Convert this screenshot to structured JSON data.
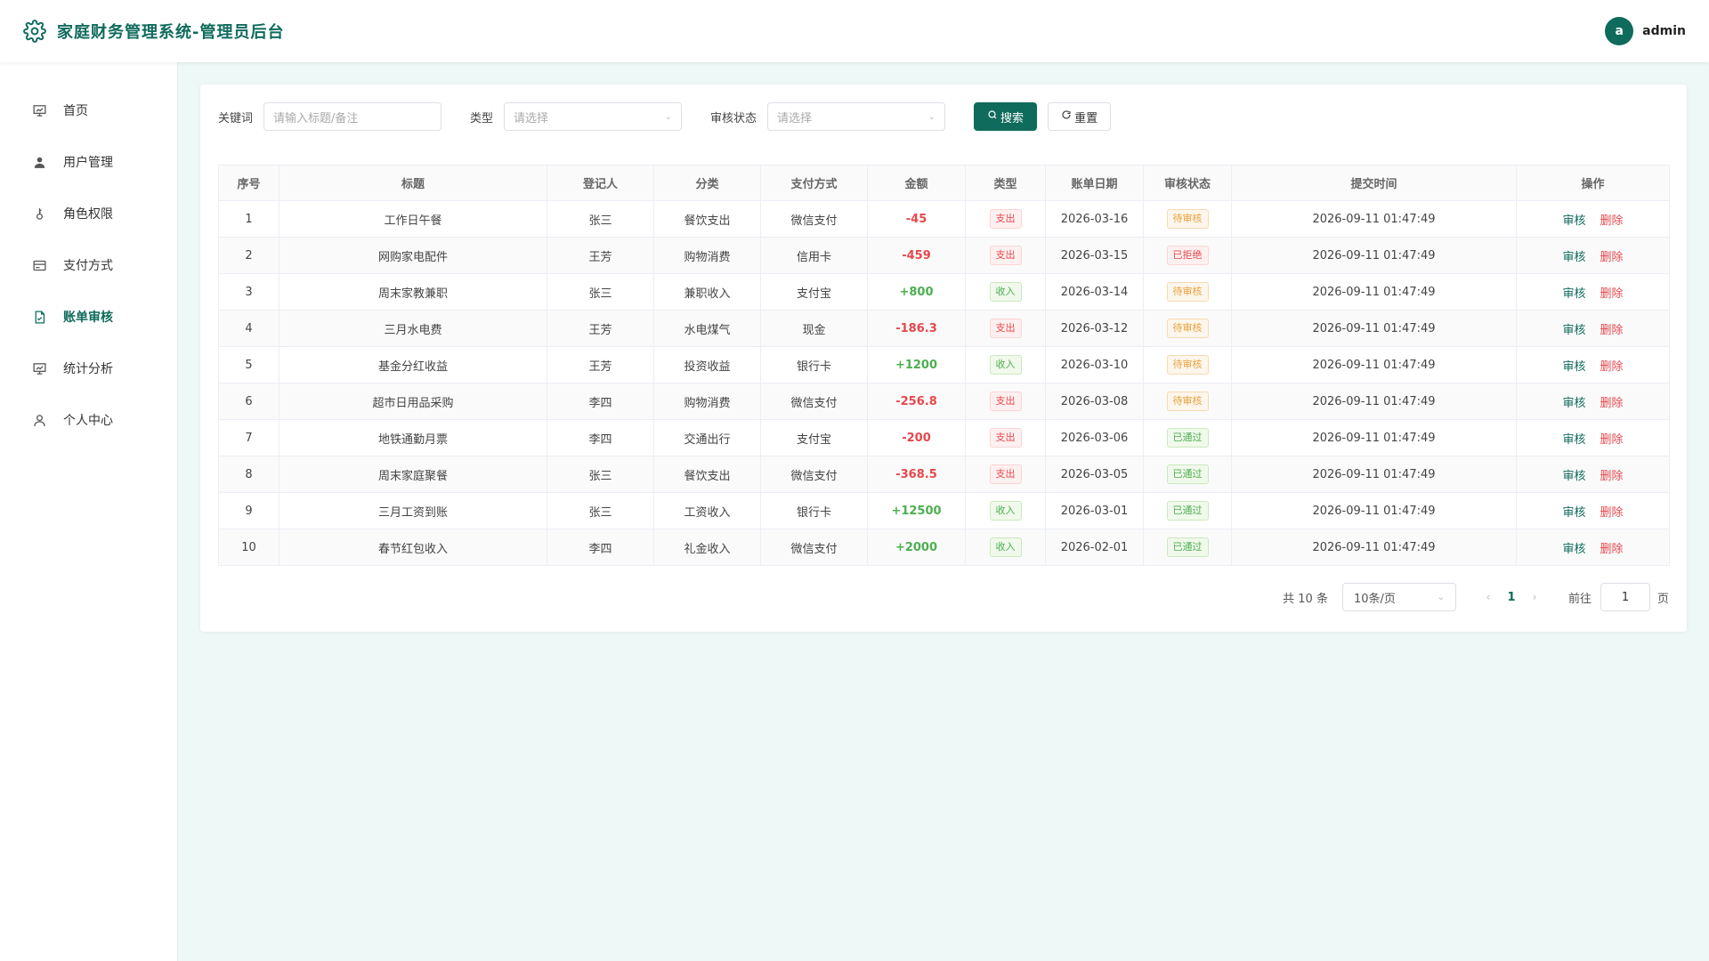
{
  "app": {
    "title": "家庭财务管理系统-管理员后台"
  },
  "user": {
    "avatar_letter": "a",
    "name": "admin"
  },
  "sidebar": {
    "items": [
      {
        "label": "首页",
        "icon": "dashboard-icon",
        "active": false
      },
      {
        "label": "用户管理",
        "icon": "user-icon",
        "active": false
      },
      {
        "label": "角色权限",
        "icon": "key-icon",
        "active": false
      },
      {
        "label": "支付方式",
        "icon": "credit-card-icon",
        "active": false
      },
      {
        "label": "账单审核",
        "icon": "document-check-icon",
        "active": true
      },
      {
        "label": "统计分析",
        "icon": "chart-icon",
        "active": false
      },
      {
        "label": "个人中心",
        "icon": "person-icon",
        "active": false
      }
    ]
  },
  "filters": {
    "keyword_label": "关键词",
    "keyword_placeholder": "请输入标题/备注",
    "type_label": "类型",
    "type_placeholder": "请选择",
    "status_label": "审核状态",
    "status_placeholder": "请选择",
    "search_label": "搜索",
    "reset_label": "重置"
  },
  "table": {
    "columns": [
      "序号",
      "标题",
      "登记人",
      "分类",
      "支付方式",
      "金额",
      "类型",
      "账单日期",
      "审核状态",
      "提交时间",
      "操作"
    ],
    "rows": [
      {
        "no": "1",
        "title": "工作日午餐",
        "person": "张三",
        "category": "餐饮支出",
        "pay": "微信支付",
        "amount": "-45",
        "type": "支出",
        "date": "2026-03-16",
        "status": "待审核",
        "submitted": "2026-09-11 01:47:49"
      },
      {
        "no": "2",
        "title": "网购家电配件",
        "person": "王芳",
        "category": "购物消费",
        "pay": "信用卡",
        "amount": "-459",
        "type": "支出",
        "date": "2026-03-15",
        "status": "已拒绝",
        "submitted": "2026-09-11 01:47:49"
      },
      {
        "no": "3",
        "title": "周末家教兼职",
        "person": "张三",
        "category": "兼职收入",
        "pay": "支付宝",
        "amount": "+800",
        "type": "收入",
        "date": "2026-03-14",
        "status": "待审核",
        "submitted": "2026-09-11 01:47:49"
      },
      {
        "no": "4",
        "title": "三月水电费",
        "person": "王芳",
        "category": "水电煤气",
        "pay": "现金",
        "amount": "-186.3",
        "type": "支出",
        "date": "2026-03-12",
        "status": "待审核",
        "submitted": "2026-09-11 01:47:49"
      },
      {
        "no": "5",
        "title": "基金分红收益",
        "person": "王芳",
        "category": "投资收益",
        "pay": "银行卡",
        "amount": "+1200",
        "type": "收入",
        "date": "2026-03-10",
        "status": "待审核",
        "submitted": "2026-09-11 01:47:49"
      },
      {
        "no": "6",
        "title": "超市日用品采购",
        "person": "李四",
        "category": "购物消费",
        "pay": "微信支付",
        "amount": "-256.8",
        "type": "支出",
        "date": "2026-03-08",
        "status": "待审核",
        "submitted": "2026-09-11 01:47:49"
      },
      {
        "no": "7",
        "title": "地铁通勤月票",
        "person": "李四",
        "category": "交通出行",
        "pay": "支付宝",
        "amount": "-200",
        "type": "支出",
        "date": "2026-03-06",
        "status": "已通过",
        "submitted": "2026-09-11 01:47:49"
      },
      {
        "no": "8",
        "title": "周末家庭聚餐",
        "person": "张三",
        "category": "餐饮支出",
        "pay": "微信支付",
        "amount": "-368.5",
        "type": "支出",
        "date": "2026-03-05",
        "status": "已通过",
        "submitted": "2026-09-11 01:47:49"
      },
      {
        "no": "9",
        "title": "三月工资到账",
        "person": "张三",
        "category": "工资收入",
        "pay": "银行卡",
        "amount": "+12500",
        "type": "收入",
        "date": "2026-03-01",
        "status": "已通过",
        "submitted": "2026-09-11 01:47:49"
      },
      {
        "no": "10",
        "title": "春节红包收入",
        "person": "李四",
        "category": "礼金收入",
        "pay": "微信支付",
        "amount": "+2000",
        "type": "收入",
        "date": "2026-02-01",
        "status": "已通过",
        "submitted": "2026-09-11 01:47:49"
      }
    ],
    "actions": {
      "audit": "审核",
      "delete": "删除"
    }
  },
  "pagination": {
    "total": "共 10 条",
    "page_size": "10条/页",
    "current_page": "1",
    "goto_label": "前往",
    "goto_value": "1",
    "page_unit": "页"
  },
  "colors": {
    "primary": "#0f6b5c",
    "expense": "#e5484d",
    "income": "#4caf50",
    "pending": "#e6a23c"
  }
}
